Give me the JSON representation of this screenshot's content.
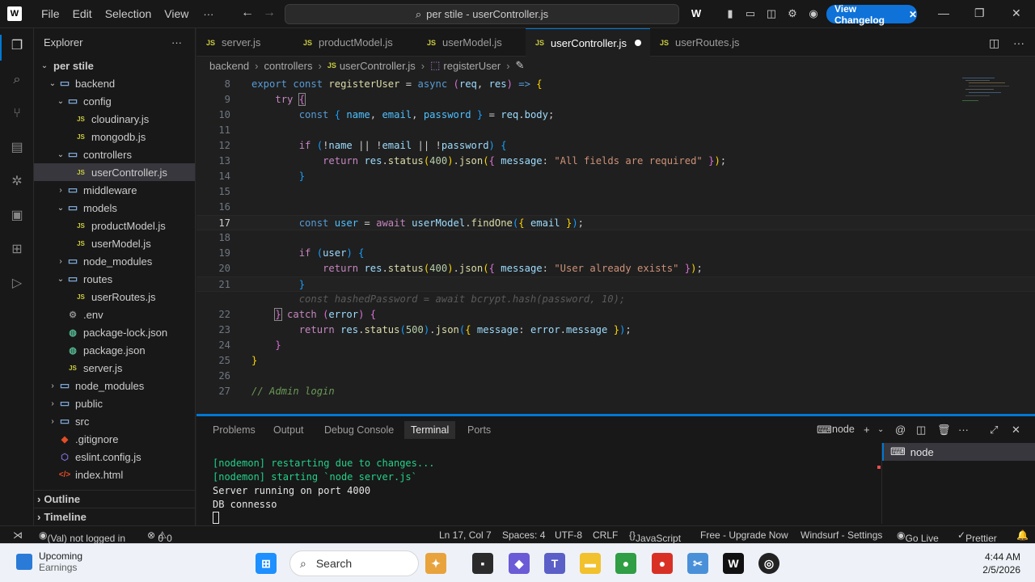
{
  "titlebar": {
    "menus": [
      "File",
      "Edit",
      "Selection",
      "View"
    ],
    "more": "···",
    "search_text": "per stile - userController.js",
    "changelog_label": "View Changelog"
  },
  "sidebar": {
    "title": "Explorer",
    "more": "···",
    "items": [
      {
        "label": "per stile",
        "depth": 0,
        "type": "folder-root",
        "open": true
      },
      {
        "label": "backend",
        "depth": 1,
        "type": "folder",
        "open": true
      },
      {
        "label": "config",
        "depth": 2,
        "type": "folder",
        "open": true
      },
      {
        "label": "cloudinary.js",
        "depth": 3,
        "type": "js"
      },
      {
        "label": "mongodb.js",
        "depth": 3,
        "type": "js"
      },
      {
        "label": "controllers",
        "depth": 2,
        "type": "folder",
        "open": true
      },
      {
        "label": "userController.js",
        "depth": 3,
        "type": "js",
        "selected": true
      },
      {
        "label": "middleware",
        "depth": 2,
        "type": "folder",
        "open": false
      },
      {
        "label": "models",
        "depth": 2,
        "type": "folder",
        "open": true
      },
      {
        "label": "productModel.js",
        "depth": 3,
        "type": "js"
      },
      {
        "label": "userModel.js",
        "depth": 3,
        "type": "js"
      },
      {
        "label": "node_modules",
        "depth": 2,
        "type": "folder",
        "open": false
      },
      {
        "label": "routes",
        "depth": 2,
        "type": "folder",
        "open": true
      },
      {
        "label": "userRoutes.js",
        "depth": 3,
        "type": "js"
      },
      {
        "label": ".env",
        "depth": 2,
        "type": "env"
      },
      {
        "label": "package-lock.json",
        "depth": 2,
        "type": "json"
      },
      {
        "label": "package.json",
        "depth": 2,
        "type": "json"
      },
      {
        "label": "server.js",
        "depth": 2,
        "type": "js"
      },
      {
        "label": "node_modules",
        "depth": 1,
        "type": "folder",
        "open": false
      },
      {
        "label": "public",
        "depth": 1,
        "type": "folder",
        "open": false
      },
      {
        "label": "src",
        "depth": 1,
        "type": "folder",
        "open": false
      },
      {
        "label": ".gitignore",
        "depth": 1,
        "type": "git"
      },
      {
        "label": "eslint.config.js",
        "depth": 1,
        "type": "eslint"
      },
      {
        "label": "index.html",
        "depth": 1,
        "type": "html"
      }
    ],
    "sections": [
      "Outline",
      "Timeline"
    ]
  },
  "tabs": [
    {
      "label": "server.js",
      "active": false
    },
    {
      "label": "productModel.js",
      "active": false
    },
    {
      "label": "userModel.js",
      "active": false
    },
    {
      "label": "userController.js",
      "active": true,
      "dirty": true
    },
    {
      "label": "userRoutes.js",
      "active": false
    }
  ],
  "breadcrumb": [
    "backend",
    "controllers",
    "userController.js",
    "registerUser"
  ],
  "editor": {
    "lines": [
      {
        "n": "8",
        "html": "<span class=\"kw\">export</span> <span class=\"kw\">const</span> <span class=\"fn\">registerUser</span> = <span class=\"kw\">async</span> <span class=\"br2\">(</span><span class=\"var\">req</span>, <span class=\"var\">res</span><span class=\"br2\">)</span> <span class=\"kw\">=&gt;</span> <span class=\"br1\">{</span>"
      },
      {
        "n": "9",
        "html": "    <span class=\"ctl\">try</span> <span class=\"br2 brhl\">{</span>"
      },
      {
        "n": "10",
        "html": "        <span class=\"kw\">const</span> <span class=\"br3\">{</span> <span class=\"cst\">name</span>, <span class=\"cst\">email</span>, <span class=\"cst\">password</span> <span class=\"br3\">}</span> = <span class=\"var\">req</span>.<span class=\"var\">body</span>;"
      },
      {
        "n": "11",
        "html": ""
      },
      {
        "n": "12",
        "html": "        <span class=\"ctl\">if</span> <span class=\"br3\">(</span>!<span class=\"var\">name</span> || !<span class=\"var\">email</span> || !<span class=\"var\">password</span><span class=\"br3\">)</span> <span class=\"br3\">{</span>"
      },
      {
        "n": "13",
        "html": "            <span class=\"ctl\">return</span> <span class=\"var\">res</span>.<span class=\"fn\">status</span><span class=\"br1\">(</span><span class=\"num\">400</span><span class=\"br1\">)</span>.<span class=\"fn\">json</span><span class=\"br1\">(</span><span class=\"br2\">{</span> <span class=\"var\">message</span>: <span class=\"str\">\"All fields are required\"</span> <span class=\"br2\">}</span><span class=\"br1\">)</span>;"
      },
      {
        "n": "14",
        "html": "        <span class=\"br3\">}</span>"
      },
      {
        "n": "15",
        "html": ""
      },
      {
        "n": "16",
        "html": ""
      },
      {
        "n": "17",
        "html": "        <span class=\"kw\">const</span> <span class=\"cst\">user</span> = <span class=\"ctl\">await</span> <span class=\"var\">userModel</span>.<span class=\"fn\">findOne</span><span class=\"br3\">(</span><span class=\"br1\">{</span> <span class=\"var\">email</span> <span class=\"br1\">}</span><span class=\"br3\">)</span>;",
        "current": true
      },
      {
        "n": "18",
        "html": ""
      },
      {
        "n": "19",
        "html": "        <span class=\"ctl\">if</span> <span class=\"br3\">(</span><span class=\"var\">user</span><span class=\"br3\">)</span> <span class=\"br3\">{</span>"
      },
      {
        "n": "20",
        "html": "            <span class=\"ctl\">return</span> <span class=\"var\">res</span>.<span class=\"fn\">status</span><span class=\"br1\">(</span><span class=\"num\">400</span><span class=\"br1\">)</span>.<span class=\"fn\">json</span><span class=\"br1\">(</span><span class=\"br2\">{</span> <span class=\"var\">message</span>: <span class=\"str\">\"User already exists\"</span> <span class=\"br2\">}</span><span class=\"br1\">)</span>;"
      },
      {
        "n": "21",
        "html": "        <span class=\"br3\">}</span>",
        "current": true
      },
      {
        "n": "",
        "html": "        <span class=\"ghost\">const hashedPassword = await bcrypt.hash(password, 10);</span>"
      },
      {
        "n": "22",
        "html": "    <span class=\"br2 brhl\">}</span> <span class=\"ctl\">catch</span> <span class=\"br2\">(</span><span class=\"var\">error</span><span class=\"br2\">)</span> <span class=\"br2\">{</span>"
      },
      {
        "n": "23",
        "html": "        <span class=\"ctl\">return</span> <span class=\"var\">res</span>.<span class=\"fn\">status</span><span class=\"br3\">(</span><span class=\"num\">500</span><span class=\"br3\">)</span>.<span class=\"fn\">json</span><span class=\"br3\">(</span><span class=\"br1\">{</span> <span class=\"var\">message</span>: <span class=\"var\">error</span>.<span class=\"var\">message</span> <span class=\"br1\">}</span><span class=\"br3\">)</span>;"
      },
      {
        "n": "24",
        "html": "    <span class=\"br2\">}</span>"
      },
      {
        "n": "25",
        "html": "<span class=\"br1\">}</span>"
      },
      {
        "n": "26",
        "html": ""
      },
      {
        "n": "27",
        "html": "<span class=\"cmt\">// Admin login</span>"
      }
    ]
  },
  "panel": {
    "tabs": [
      "Problems",
      "Output",
      "Debug Console",
      "Terminal",
      "Ports"
    ],
    "active_tab": "Terminal",
    "terminal_name": "node",
    "terminal_list_item": "node",
    "output": [
      {
        "text": "[nodemon] restarting due to changes...",
        "color": "green"
      },
      {
        "text": "[nodemon] starting `node server.js`",
        "color": "green"
      },
      {
        "text": "Server running on port 4000",
        "color": "white"
      },
      {
        "text": "DB connesso",
        "color": "white"
      }
    ]
  },
  "statusbar": {
    "account": "(Val) not logged in",
    "errors": "0",
    "warnings": "0",
    "position": "Ln 17, Col 7",
    "spaces": "Spaces: 4",
    "encoding": "UTF-8",
    "eol": "CRLF",
    "language": "JavaScript",
    "upgrade": "Free - Upgrade Now",
    "windsurf": "Windsurf - Settings",
    "golive": "Go Live",
    "prettier": "Prettier"
  },
  "taskbar": {
    "weather_title": "Upcoming",
    "weather_sub": "Earnings",
    "search_label": "Search",
    "time": "4:44 AM",
    "date": "2/5/2026"
  },
  "colors": {
    "accent": "#0078d4",
    "changelog": "#0e72d9",
    "terminal_green": "#23d18b"
  }
}
